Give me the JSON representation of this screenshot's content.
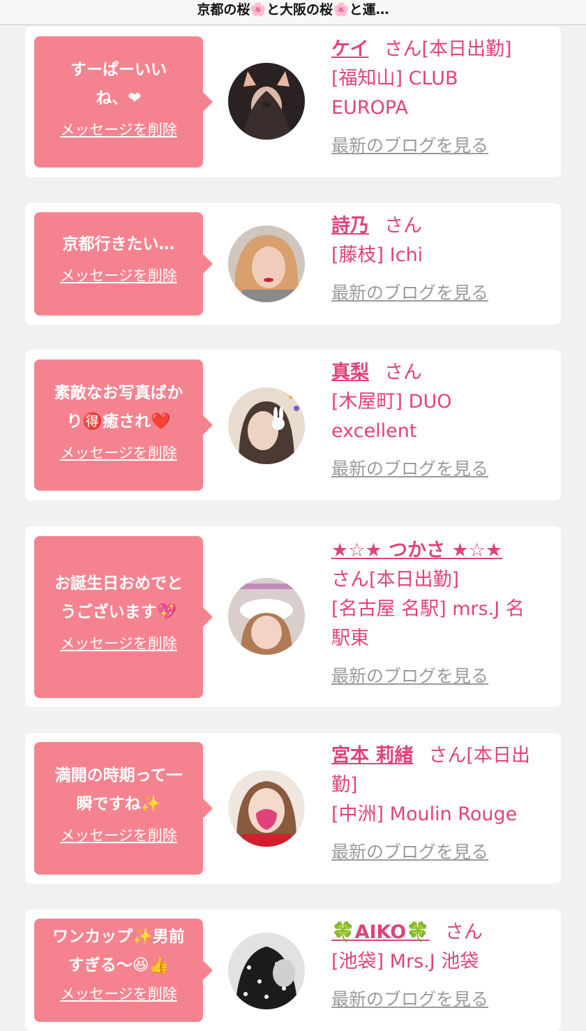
{
  "header": {
    "title": "京都の桜🌸と大阪の桜🌸と運…"
  },
  "colors": {
    "bubble": "#f5838f",
    "accent": "#e0427a",
    "link_gray": "#9a9a9a",
    "background": "#f1f1f1"
  },
  "common": {
    "delete_label": "メッセージを削除",
    "blog_label": "最新のブログを見る"
  },
  "messages": [
    {
      "message_lines": [
        "すーぱーいい",
        "ね、❤︎"
      ],
      "name": "ケイ",
      "suffix": "さん[本日出勤]",
      "shop_lines": [
        "[福知山] CLUB",
        "EUROPA"
      ]
    },
    {
      "message_lines": [
        "京都行きたい…"
      ],
      "name": "詩乃",
      "suffix": "さん",
      "shop_lines": [
        "[藤枝] Ichi"
      ]
    },
    {
      "message_lines": [
        "素敵なお写真ばか",
        "り🉐癒され❤️"
      ],
      "name": "真梨",
      "suffix": "さん",
      "shop_lines": [
        "[木屋町] DUO",
        "excellent"
      ]
    },
    {
      "message_lines": [
        "お誕生日おめでと",
        "うございます💖"
      ],
      "name": "★☆★ つかさ ★☆★",
      "suffix": "さん[本日出勤]",
      "shop_lines": [
        "[名古屋 名駅] mrs.J 名",
        "駅東"
      ]
    },
    {
      "message_lines": [
        "満開の時期って一",
        "瞬ですね✨"
      ],
      "name": "宮本 莉緒",
      "suffix": "さん[本日出",
      "suffix_line2": "勤]",
      "shop_lines": [
        "[中洲] Moulin Rouge"
      ]
    },
    {
      "message_lines": [
        "ワンカップ✨男前",
        "すぎる〜😆👍"
      ],
      "name": "🍀AIKO🍀",
      "suffix": "さん",
      "shop_lines": [
        "[池袋] Mrs.J 池袋"
      ]
    }
  ]
}
